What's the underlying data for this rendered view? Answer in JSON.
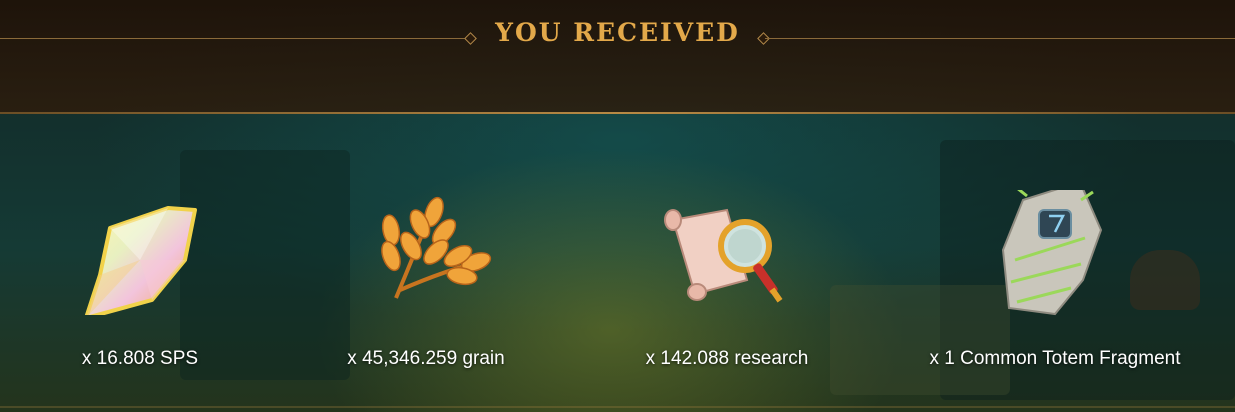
{
  "dialog": {
    "title": "YOU RECEIVED"
  },
  "rewards": [
    {
      "icon": "sps-crystal-icon",
      "label": "x 16.808 SPS"
    },
    {
      "icon": "grain-icon",
      "label": "x 45,346.259 grain"
    },
    {
      "icon": "research-scroll-icon",
      "label": "x 142.088 research"
    },
    {
      "icon": "totem-fragment-icon",
      "label": "x 1 Common Totem Fragment"
    }
  ],
  "colors": {
    "title": "#e3a94a",
    "label": "#ffffff",
    "accent_line": "#8a6a3a"
  }
}
